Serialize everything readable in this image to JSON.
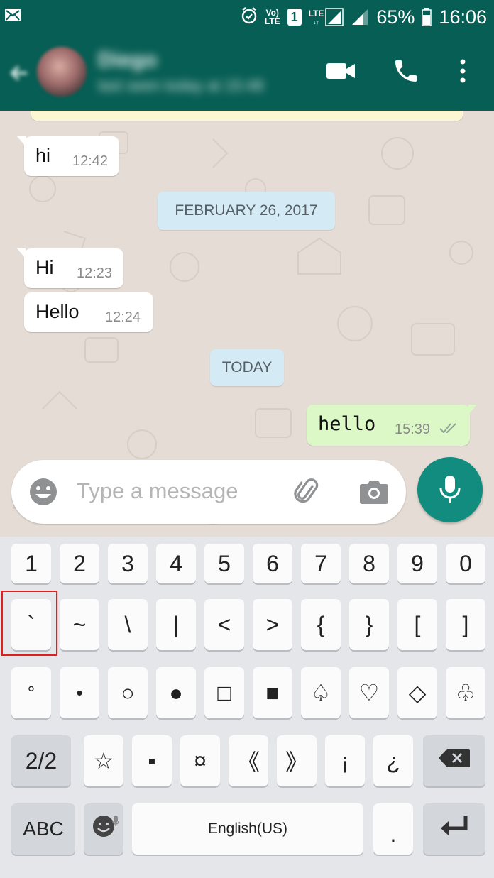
{
  "status_bar": {
    "volte_top": "Vo)",
    "volte_bottom": "LTE",
    "sim": "1",
    "lte": "LTE",
    "battery_percent": "65%",
    "time": "16:06"
  },
  "header": {
    "contact_name": "Diego",
    "contact_status": "last seen today at 15:48"
  },
  "chat": {
    "messages": [
      {
        "text": "hi",
        "time": "12:42"
      },
      {
        "text": "Hi",
        "time": "12:23"
      },
      {
        "text": "Hello",
        "time": "12:24"
      },
      {
        "text": "hello",
        "time": "15:39"
      }
    ],
    "date_dividers": [
      "FEBRUARY 26, 2017",
      "TODAY"
    ]
  },
  "input": {
    "placeholder": "Type a message"
  },
  "keyboard": {
    "row1": [
      "1",
      "2",
      "3",
      "4",
      "5",
      "6",
      "7",
      "8",
      "9",
      "0"
    ],
    "row2": [
      "`",
      "~",
      "\\",
      "|",
      "<",
      ">",
      "{",
      "}",
      "[",
      "]"
    ],
    "row3": [
      "°",
      "•",
      "○",
      "●",
      "□",
      "■",
      "♤",
      "♡",
      "◇",
      "♧"
    ],
    "row4": [
      "2/2",
      "☆",
      "▪",
      "¤",
      "《",
      "》",
      "¡",
      "¿"
    ],
    "row5": {
      "abc": "ABC",
      "space": "English(US)",
      "period": "."
    }
  },
  "colors": {
    "header": "#075e54",
    "accent": "#128c7e",
    "outgoing_bubble": "#dcf8c6",
    "date_pill": "#d4eaf4",
    "highlight": "#e0201c"
  }
}
